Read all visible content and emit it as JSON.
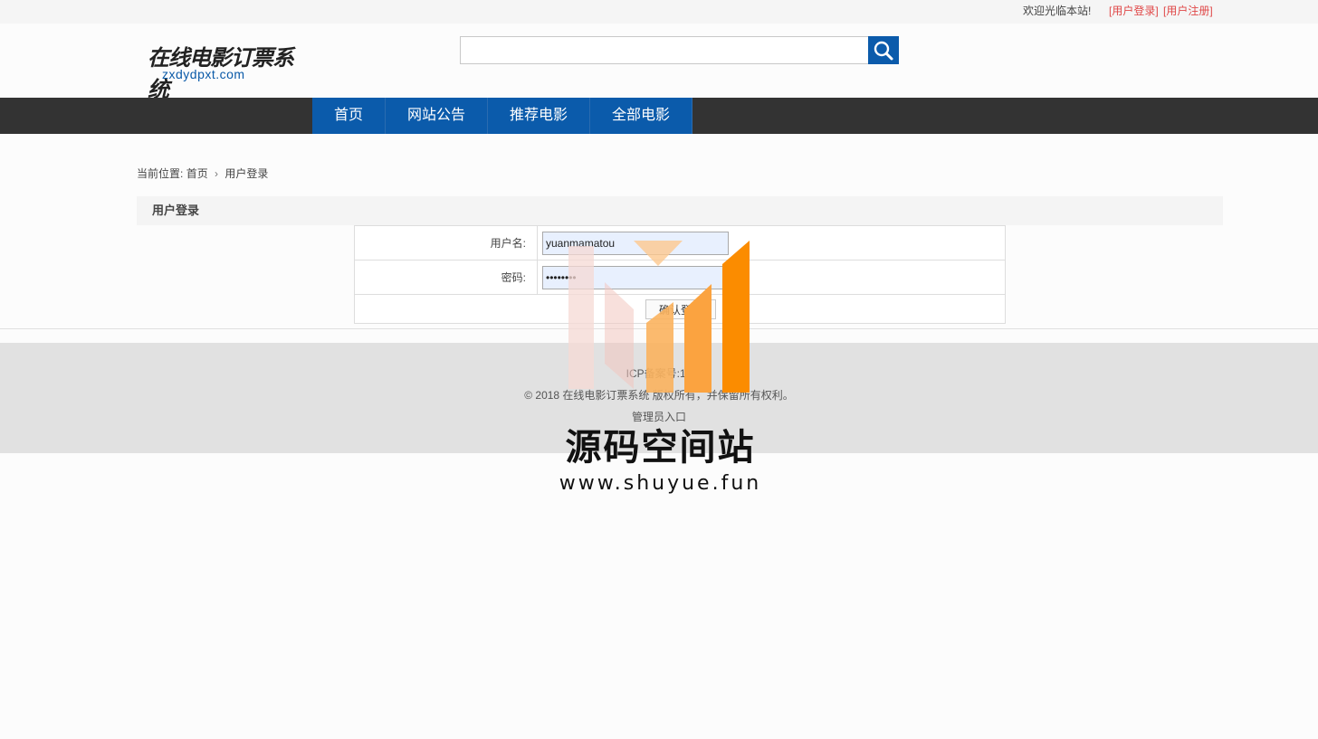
{
  "topbar": {
    "welcome": "欢迎光临本站!",
    "login_link": "[用户登录]",
    "register_link": "[用户注册]"
  },
  "header": {
    "logo_cn": "在线电影订票系统",
    "logo_en": "zxdydpxt.com",
    "search_placeholder": "",
    "search_icon": "search-icon"
  },
  "nav": {
    "items": [
      {
        "label": "首页"
      },
      {
        "label": "网站公告"
      },
      {
        "label": "推荐电影"
      },
      {
        "label": "全部电影"
      }
    ]
  },
  "breadcrumb": {
    "prefix": "当前位置:",
    "home": "首页",
    "separator": "›",
    "current": "用户登录"
  },
  "login_panel": {
    "title": "用户登录",
    "username_label": "用户名:",
    "username_value": "yuanmamatou",
    "password_label": "密码:",
    "password_value": "••••••••",
    "submit_label": "确认登录"
  },
  "footer": {
    "icp": "ICP备案号:12",
    "copyright": "© 2018 在线电影订票系统 版权所有，并保留所有权利。",
    "admin_link": "管理员入口"
  },
  "watermark": {
    "title": "源码空间站",
    "url": "www.shuyue.fun"
  },
  "colors": {
    "nav_blue": "#0b5bab",
    "nav_bar": "#333333",
    "link_red": "#e04848",
    "footer_bg": "#e1e1e1",
    "watermark_orange": "#fb8c00"
  }
}
